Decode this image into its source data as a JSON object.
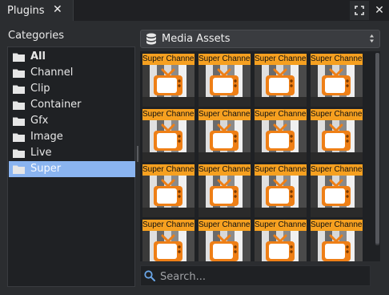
{
  "window": {
    "tab_title": "Plugins",
    "tab_close_icon": "close-icon",
    "maximize_icon": "maximize-icon",
    "close_icon": "close-icon"
  },
  "categories": {
    "label": "Categories",
    "items": [
      {
        "label": "All",
        "icon": "folder-icon",
        "selected": false,
        "bold": true
      },
      {
        "label": "Channel",
        "icon": "folder-icon",
        "selected": false,
        "bold": false
      },
      {
        "label": "Clip",
        "icon": "folder-icon",
        "selected": false,
        "bold": false
      },
      {
        "label": "Container",
        "icon": "folder-icon",
        "selected": false,
        "bold": false
      },
      {
        "label": "Gfx",
        "icon": "folder-icon",
        "selected": false,
        "bold": false
      },
      {
        "label": "Image",
        "icon": "folder-icon",
        "selected": false,
        "bold": false
      },
      {
        "label": "Live",
        "icon": "folder-icon",
        "selected": false,
        "bold": false
      },
      {
        "label": "Super",
        "icon": "folder-icon",
        "selected": true,
        "bold": false
      }
    ]
  },
  "source_dropdown": {
    "icon": "database-icon",
    "selected": "Media Assets"
  },
  "assets": {
    "tile_label": "Super Channel",
    "tile_icon": "tv-icon",
    "rows": 4,
    "columns": 4
  },
  "search": {
    "icon": "search-icon",
    "placeholder": "Search...",
    "value": ""
  },
  "colors": {
    "selection": "#8ab4f0",
    "tile_header": "#f6a020",
    "tv_orange": "#ee7f16",
    "panel_bg": "#2b2d30",
    "list_bg": "#1f2124"
  }
}
